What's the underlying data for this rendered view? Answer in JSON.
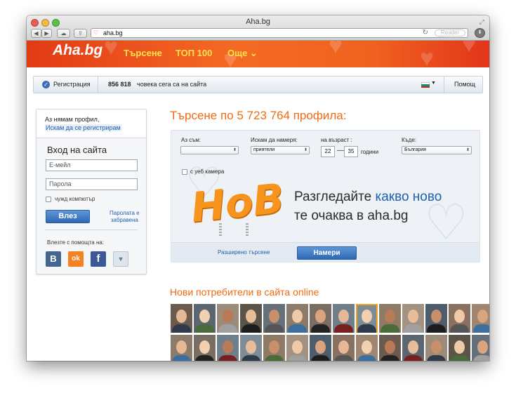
{
  "window": {
    "title": "Aha.bg"
  },
  "browser": {
    "url": "aha.bg",
    "reader_label": "Reader"
  },
  "header": {
    "logo": "Aha.bg",
    "nav": [
      {
        "label": "Търсене"
      },
      {
        "label": "ТОП 100"
      },
      {
        "label": "Още ⌄"
      }
    ]
  },
  "toolbar": {
    "register_label": "Регистрация",
    "online_count": "856 818",
    "online_text": "човека сега са на сайта",
    "help_label": "Помощ"
  },
  "login": {
    "no_profile": "Аз нямам профил,",
    "register_link": "Искам да се регистрирам",
    "title": "Вход на сайта",
    "email_placeholder": "Е-мейл",
    "password_placeholder": "Парола",
    "foreign_pc": "чужд компютър",
    "login_button": "Влез",
    "forgot_password_1": "Паролата е",
    "forgot_password_2": "забравена",
    "social_label": "Влезте с помощта на:",
    "social": [
      "В",
      "ok",
      "f",
      "▾"
    ]
  },
  "search": {
    "title": "Търсене по 5 723 764 профила:",
    "i_am_label": "Аз съм:",
    "i_am_value": "",
    "looking_for_label": "Искам да намеря:",
    "looking_for_value": "приятели",
    "age_label": "на възраст :",
    "age_from": "22",
    "age_to": "35",
    "age_units": "години",
    "where_label": "Къде:",
    "where_value": "България",
    "webcam_label": "с уеб камера",
    "promo_big": "НоВ",
    "promo_line1_a": "Разгледайте ",
    "promo_line1_b": "какво ново",
    "promo_line2": "те очаква в aha.bg",
    "advanced_link": "Разширено търсене",
    "find_button": "Намери"
  },
  "online": {
    "title": "Нови потребители в сайта online"
  },
  "colors": {
    "accent_orange": "#f26a11",
    "link_blue": "#1f5fb0",
    "button_blue": "#2f68b3",
    "nav_yellow": "#ffe14d"
  }
}
